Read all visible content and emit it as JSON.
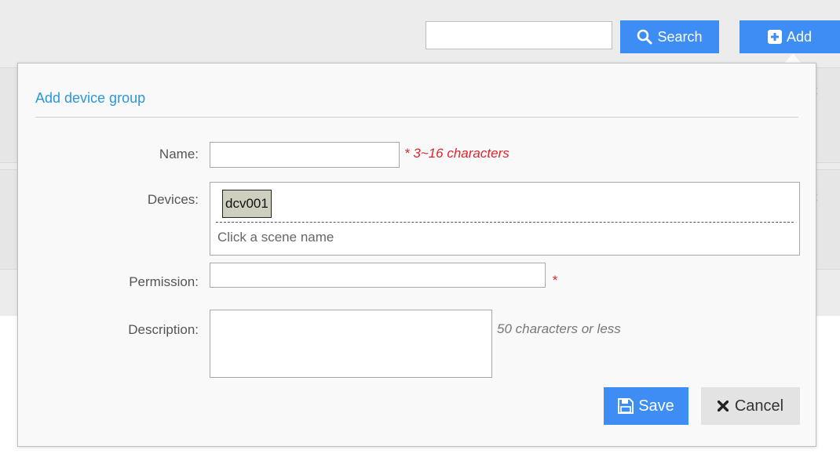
{
  "toolbar": {
    "search_value": "",
    "search_label": "Search",
    "search_icon": "search-icon",
    "add_label": "Add",
    "add_icon": "plus-square-icon"
  },
  "dialog": {
    "title": "Add device group",
    "name": {
      "label": "Name:",
      "value": "",
      "hint": "* 3~16 characters"
    },
    "devices": {
      "label": "Devices:",
      "items": [
        "dcv001"
      ],
      "hint": "Click a scene name"
    },
    "permission": {
      "label": "Permission:",
      "value": "",
      "required": "*"
    },
    "description": {
      "label": "Description:",
      "value": "",
      "hint": "50 characters or less"
    },
    "save_label": "Save",
    "save_icon": "floppy-disk-icon",
    "cancel_label": "Cancel",
    "cancel_icon": "close-icon"
  },
  "colors": {
    "accent": "#3d8df5",
    "title": "#2a97d8",
    "required": "#d8262d"
  }
}
